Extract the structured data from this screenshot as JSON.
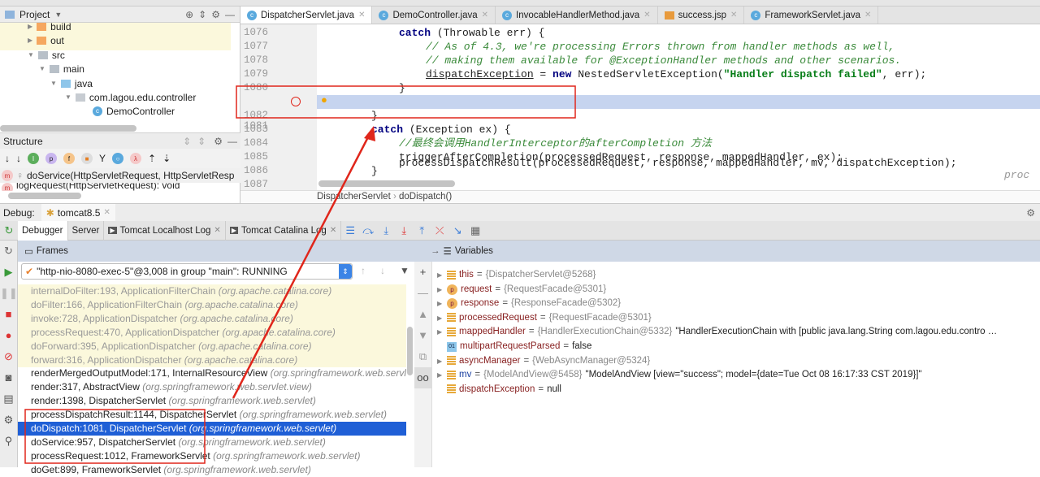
{
  "project_panel": {
    "title": "Project",
    "tree": [
      {
        "label": "build",
        "type": "folder-orange"
      },
      {
        "label": "out",
        "type": "folder-orange"
      },
      {
        "label": "src",
        "type": "folder"
      },
      {
        "label": "main",
        "type": "folder"
      },
      {
        "label": "java",
        "type": "folder-blue"
      },
      {
        "label": "com.lagou.edu.controller",
        "type": "package"
      },
      {
        "label": "DemoController",
        "type": "class"
      }
    ]
  },
  "structure_panel": {
    "title": "Structure",
    "items": [
      {
        "label": "doService(HttpServletRequest, HttpServletResp"
      },
      {
        "label": "logRequest(HttpServletRequest): void"
      }
    ]
  },
  "editor": {
    "tabs": [
      {
        "label": "DispatcherServlet.java",
        "active": true
      },
      {
        "label": "DemoController.java"
      },
      {
        "label": "InvocableHandlerMethod.java"
      },
      {
        "label": "success.jsp"
      },
      {
        "label": "FrameworkServlet.java"
      }
    ],
    "lines": [
      "1076",
      "1077",
      "1078",
      "1079",
      "1080",
      "1081",
      "1082",
      "1083",
      "1084",
      "1085",
      "1086",
      "1087"
    ],
    "code": {
      "l1076_kw": "catch",
      "l1076_rest": " (Throwable err) {",
      "l1077": "// As of 4.3, we're processing Errors thrown from handler methods as well,",
      "l1078": "// making them available for @ExceptionHandler methods and other scenarios.",
      "l1079_a": "dispatchException",
      "l1079_b": " = ",
      "l1079_kw": "new",
      "l1079_c": " NestedServletException(",
      "l1079_str": "\"Handler dispatch failed\"",
      "l1079_d": ", err);",
      "l1080": "}",
      "l1081": "processDispatchResult(processedRequest, response, mappedHandler, mv, dispatchException);",
      "l1081_hint": "proc",
      "l1082": "}",
      "l1083_kw": "catch",
      "l1083_rest": " (Exception ex) {",
      "l1084": "//最终会调用HandlerInterceptor的afterCompletion 方法",
      "l1085": "triggerAfterCompletion(processedRequest, response, mappedHandler, ex);",
      "l1086": "}"
    },
    "breadcrumb": [
      "DispatcherServlet",
      "doDispatch()"
    ]
  },
  "debug": {
    "label": "Debug:",
    "session": "tomcat8.5",
    "tabs": [
      "Debugger",
      "Server",
      "Tomcat Localhost Log",
      "Tomcat Catalina Log"
    ],
    "frames_title": "Frames",
    "thread": "\"http-nio-8080-exec-5\"@3,008 in group \"main\": RUNNING",
    "frames": [
      {
        "method": "internalDoFilter:193, ApplicationFilterChain",
        "pkg": "(org.apache.catalina.core)",
        "lib": true
      },
      {
        "method": "doFilter:166, ApplicationFilterChain",
        "pkg": "(org.apache.catalina.core)",
        "lib": true
      },
      {
        "method": "invoke:728, ApplicationDispatcher",
        "pkg": "(org.apache.catalina.core)",
        "lib": true
      },
      {
        "method": "processRequest:470, ApplicationDispatcher",
        "pkg": "(org.apache.catalina.core)",
        "lib": true
      },
      {
        "method": "doForward:395, ApplicationDispatcher",
        "pkg": "(org.apache.catalina.core)",
        "lib": true
      },
      {
        "method": "forward:316, ApplicationDispatcher",
        "pkg": "(org.apache.catalina.core)",
        "lib": true
      },
      {
        "method": "renderMergedOutputModel:171, InternalResourceView",
        "pkg": "(org.springframework.web.servlet.view)"
      },
      {
        "method": "render:317, AbstractView",
        "pkg": "(org.springframework.web.servlet.view)"
      },
      {
        "method": "render:1398, DispatcherServlet",
        "pkg": "(org.springframework.web.servlet)"
      },
      {
        "method": "processDispatchResult:1144, DispatcherServlet",
        "pkg": "(org.springframework.web.servlet)"
      },
      {
        "method": "doDispatch:1081, DispatcherServlet",
        "pkg": "(org.springframework.web.servlet)",
        "selected": true
      },
      {
        "method": "doService:957, DispatcherServlet",
        "pkg": "(org.springframework.web.servlet)"
      },
      {
        "method": "processRequest:1012, FrameworkServlet",
        "pkg": "(org.springframework.web.servlet)"
      },
      {
        "method": "doGet:899, FrameworkServlet",
        "pkg": "(org.springframework.web.servlet)"
      }
    ],
    "variables_title": "Variables",
    "variables": [
      {
        "name": "this",
        "ref": "{DispatcherServlet@5268}",
        "value": "",
        "icon": "field"
      },
      {
        "name": "request",
        "ref": "{RequestFacade@5301}",
        "value": "",
        "icon": "param"
      },
      {
        "name": "response",
        "ref": "{ResponseFacade@5302}",
        "value": "",
        "icon": "param"
      },
      {
        "name": "processedRequest",
        "ref": "{RequestFacade@5301}",
        "value": "",
        "icon": "field"
      },
      {
        "name": "mappedHandler",
        "ref": "{HandlerExecutionChain@5332}",
        "value": "\"HandlerExecutionChain with [public java.lang.String com.lagou.edu.contro …",
        "icon": "field"
      },
      {
        "name": "multipartRequestParsed",
        "ref": "",
        "value": "false",
        "icon": "boolean"
      },
      {
        "name": "asyncManager",
        "ref": "{WebAsyncManager@5324}",
        "value": "",
        "icon": "field"
      },
      {
        "name": "mv",
        "ref": "{ModelAndView@5458}",
        "value": "\"ModelAndView [view=\"success\"; model={date=Tue Oct 08 16:17:33 CST 2019}]\"",
        "icon": "field"
      },
      {
        "name": "dispatchException",
        "ref": "",
        "value": "null",
        "icon": "field"
      }
    ]
  },
  "colors": {
    "selection": "#1f5fd6",
    "exec_line": "#c6d4ef",
    "annotation": "#e0261b"
  }
}
